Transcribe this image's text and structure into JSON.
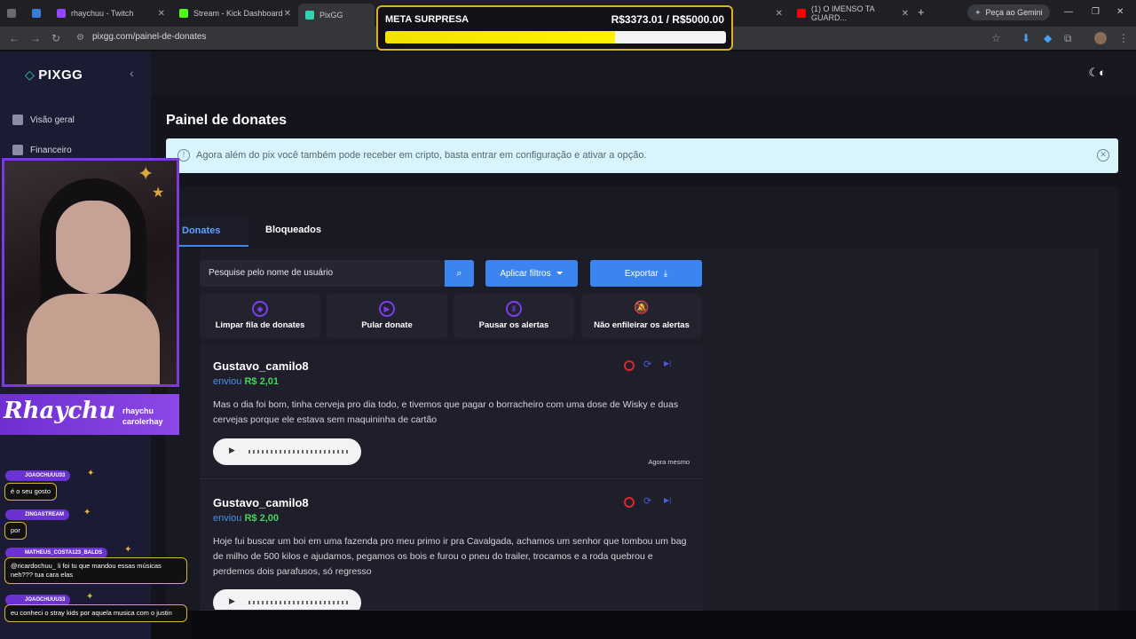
{
  "browser": {
    "tabs": [
      {
        "label": "rhaychuu - Twitch",
        "color": "#9146ff"
      },
      {
        "label": "Stream - Kick Dashboard",
        "color": "#53fc18"
      },
      {
        "label": "PixGG",
        "color": "#34d1b3"
      },
      {
        "label": "(1) O IMENSO TA GUARD...",
        "color": "#ff0000"
      }
    ],
    "url": "pixgg.com/painel-de-donates",
    "gemini": "Peça ao Gemini"
  },
  "meta": {
    "title": "META SURPRESA",
    "amount": "R$3373.01 / R$5000.00",
    "progress": 0.675
  },
  "sidebar": {
    "logo": "PIXGG",
    "items": [
      {
        "label": "Visão geral"
      },
      {
        "label": "Financeiro"
      }
    ]
  },
  "main": {
    "title": "Painel de donates",
    "banner": "Agora além do pix você também pode receber em cripto, basta entrar em configuração e ativar a opção.",
    "tabs": [
      {
        "label": "Donates"
      },
      {
        "label": "Bloqueados"
      }
    ],
    "search_placeholder": "Pesquise pelo nome de usuário",
    "filters_label": "Aplicar filtros",
    "export_label": "Exportar",
    "actions": [
      {
        "label": "Limpar fila de donates"
      },
      {
        "label": "Pular donate"
      },
      {
        "label": "Pausar os alertas"
      },
      {
        "label": "Não enfileirar os alertas"
      }
    ],
    "donates": [
      {
        "name": "Gustavo_camilo8",
        "sent": "enviou",
        "value": "R$ 2,01",
        "message": "Mas o dia foi bom, tinha cerveja pro dia todo, e tivemos que pagar o borracheiro com uma dose de Wisky e duas cervejas porque ele estava sem maquininha de cartão",
        "time": "Agora mesmo"
      },
      {
        "name": "Gustavo_camilo8",
        "sent": "enviou",
        "value": "R$ 2,00",
        "message": "Hoje fui buscar um boi em uma fazenda pro meu primo ir pra Cavalgada, achamos um senhor que tombou um bag de milho de 500 kilos e ajudamos, pegamos os bois e furou o pneu do trailer, trocamos e a roda quebrou e perdemos dois parafusos, só regresso",
        "time": ""
      }
    ]
  },
  "stream": {
    "name": "Rhaychu",
    "handles": [
      "rhaychu",
      "carolerhay"
    ],
    "chat": [
      {
        "user": "JOAOCHUUU33",
        "msg": "é o seu gosto"
      },
      {
        "user": "ZINGASTREAM",
        "msg": "por"
      },
      {
        "user": "MATHEUS_COSTA123_BALDS",
        "msg": "@ricardochuu_ li foi tu que mandou essas músicas neh??? tua cara elas"
      },
      {
        "user": "JOAOCHUUU33",
        "msg": "eu conheci o stray kids por aquela musica com o justin"
      }
    ]
  }
}
